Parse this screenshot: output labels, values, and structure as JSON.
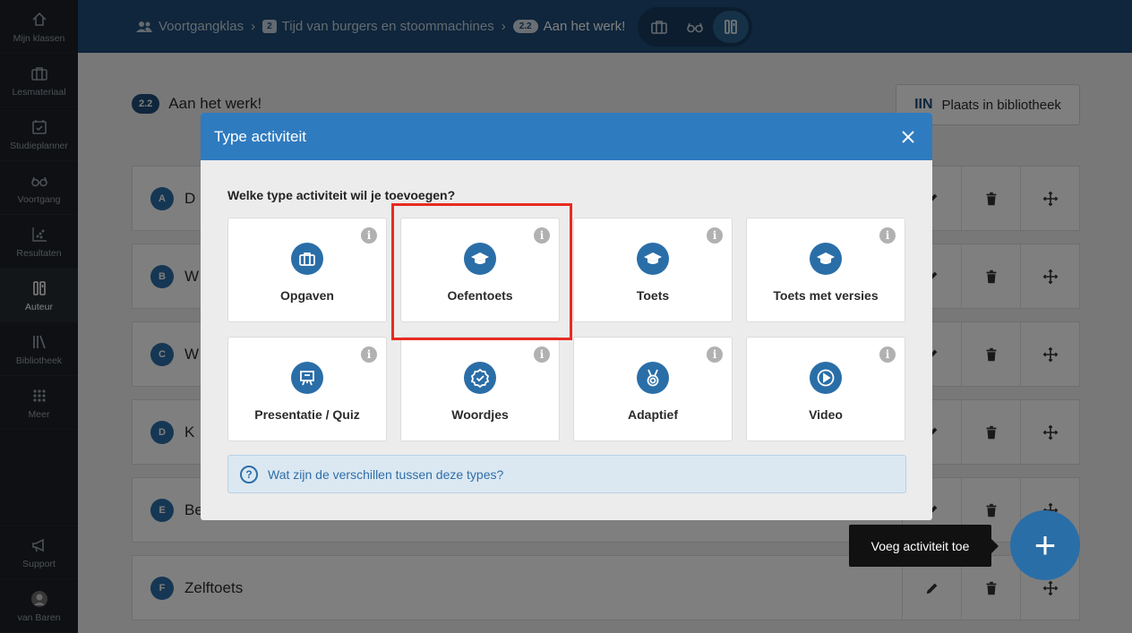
{
  "sidebar": {
    "items": [
      {
        "label": "Mijn klassen",
        "icon": "home-icon"
      },
      {
        "label": "Lesmateriaal",
        "icon": "briefcase-icon"
      },
      {
        "label": "Studieplanner",
        "icon": "calendar-check-icon"
      },
      {
        "label": "Voortgang",
        "icon": "glasses-icon"
      },
      {
        "label": "Resultaten",
        "icon": "chart-icon"
      },
      {
        "label": "Auteur",
        "icon": "author-icon",
        "active": true
      },
      {
        "label": "Bibliotheek",
        "icon": "library-icon"
      },
      {
        "label": "Meer",
        "icon": "grid-icon"
      }
    ],
    "support_label": "Support",
    "user_label": "van Baren"
  },
  "breadcrumb": {
    "class_name": "Voortgangklas",
    "chapter_number": "2",
    "chapter_title": "Tijd van burgers en stoommachines",
    "section_number": "2.2",
    "section_title": "Aan het werk!"
  },
  "main": {
    "section_number": "2.2",
    "section_title": "Aan het werk!",
    "library_button": "Plaats in bibliotheek",
    "library_icon": "IIN",
    "rows": [
      {
        "letter": "A",
        "title": "D"
      },
      {
        "letter": "B",
        "title": "W"
      },
      {
        "letter": "C",
        "title": "W"
      },
      {
        "letter": "D",
        "title": "K"
      },
      {
        "letter": "E",
        "title": "Be"
      },
      {
        "letter": "F",
        "title": "Zelftoets"
      }
    ]
  },
  "modal": {
    "title": "Type activiteit",
    "question": "Welke type activiteit wil je toevoegen?",
    "types": [
      {
        "name": "Opgaven",
        "icon": "briefcase-icon"
      },
      {
        "name": "Oefentoets",
        "icon": "graduation-cap-icon"
      },
      {
        "name": "Toets",
        "icon": "graduation-cap-icon"
      },
      {
        "name": "Toets met versies",
        "icon": "graduation-cap-icon"
      },
      {
        "name": "Presentatie / Quiz",
        "icon": "presentation-icon"
      },
      {
        "name": "Woordjes",
        "icon": "badge-check-icon"
      },
      {
        "name": "Adaptief",
        "icon": "medal-icon"
      },
      {
        "name": "Video",
        "icon": "play-icon"
      }
    ],
    "info_glyph": "i",
    "help_text": "Wat zijn de verschillen tussen deze types?",
    "help_glyph": "?"
  },
  "fab": {
    "tooltip": "Voeg activiteit toe",
    "glyph": "+"
  },
  "colors": {
    "primary": "#2a6ea8",
    "header": "#2f7bbf",
    "topbar": "#1f4d78",
    "sidebar": "#1c2126",
    "highlight": "#e82b21"
  }
}
